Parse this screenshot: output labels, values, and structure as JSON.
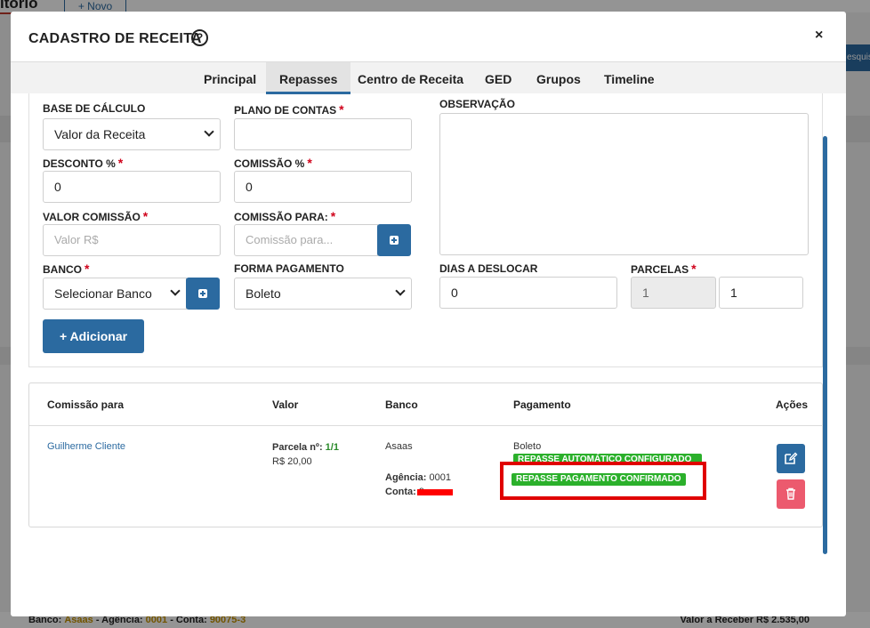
{
  "background": {
    "page_title": "itório",
    "new_button": "+ Novo",
    "search_partial": "esquis",
    "footer": {
      "bank_label": "Banco:",
      "bank_value": "Asaas",
      "agency_label": "- Agência:",
      "agency_value": "0001",
      "account_label": "- Conta:",
      "account_value": "90075-3",
      "receivable": "Valor a Receber R$ 2.535,00"
    }
  },
  "modal": {
    "title": "CADASTRO DE RECEITA",
    "help_glyph": "?",
    "close_glyph": "×",
    "tabs": [
      {
        "label": "Principal"
      },
      {
        "label": "Repasses"
      },
      {
        "label": "Centro de Receita"
      },
      {
        "label": "GED"
      },
      {
        "label": "Grupos"
      },
      {
        "label": "Timeline"
      }
    ],
    "active_tab": "Repasses"
  },
  "form": {
    "base_calculo": {
      "label": "BASE DE CÁLCULO",
      "value": "Valor da Receita"
    },
    "plano_contas": {
      "label": "PLANO DE CONTAS",
      "value": ""
    },
    "observacao": {
      "label": "OBSERVAÇÃO",
      "value": ""
    },
    "desconto": {
      "label": "DESCONTO %",
      "value": "0"
    },
    "comissao_pct": {
      "label": "COMISSÃO %",
      "value": "0"
    },
    "valor_comissao": {
      "label": "VALOR COMISSÃO",
      "placeholder": "Valor R$"
    },
    "comissao_para": {
      "label": "COMISSÃO PARA:",
      "placeholder": "Comissão para..."
    },
    "banco": {
      "label": "BANCO",
      "value": "Selecionar Banco"
    },
    "forma_pagamento": {
      "label": "FORMA PAGAMENTO",
      "value": "Boleto"
    },
    "dias_deslocar": {
      "label": "DIAS A DESLOCAR",
      "value": "0"
    },
    "parcelas": {
      "label": "PARCELAS",
      "value_from": "1",
      "value_to": "1"
    },
    "required_mark": "*",
    "add_button": "+ Adicionar"
  },
  "table": {
    "headers": {
      "comissao_para": "Comissão para",
      "valor": "Valor",
      "banco": "Banco",
      "pagamento": "Pagamento",
      "acoes": "Ações"
    },
    "rows": [
      {
        "comissao_para": "Guilherme Cliente",
        "parcela_label": "Parcela nº:",
        "parcela_value": "1/1",
        "valor": "R$ 20,00",
        "banco": "Asaas",
        "agencia_label": "Agência:",
        "agencia_value": "0001",
        "conta_label": "Conta:",
        "conta_value": "9",
        "pagamento": "Boleto",
        "badge_auto": "REPASSE AUTOMÁTICO CONFIGURADO",
        "badge_confirmed": "REPASSE PAGAMENTO CONFIRMADO"
      }
    ]
  },
  "colors": {
    "primary": "#2b6aa0",
    "required": "#d0021b",
    "badge_green": "#2bb02b",
    "delete": "#ec5a6e",
    "highlight": "#e00000"
  }
}
